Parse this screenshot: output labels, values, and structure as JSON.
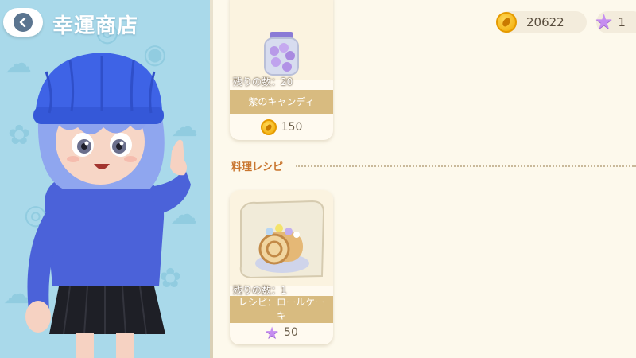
{
  "header": {
    "title": "幸運商店"
  },
  "currency": {
    "coins": "20622",
    "stars": "1"
  },
  "section": {
    "recipes_label": "料理レシピ"
  },
  "items": [
    {
      "remaining": "残りの数：20",
      "name": "紫のキャンディ",
      "price": "150",
      "currency_icon": "coin-icon"
    },
    {
      "remaining": "残りの数：1",
      "name": "レシピ：ロールケーキ",
      "price": "50",
      "currency_icon": "star-icon"
    }
  ],
  "colors": {
    "panel_bg": "#a9d9ea",
    "page_bg": "#fdf9ec",
    "band": "#d8bb80",
    "accent": "#c9762f"
  }
}
